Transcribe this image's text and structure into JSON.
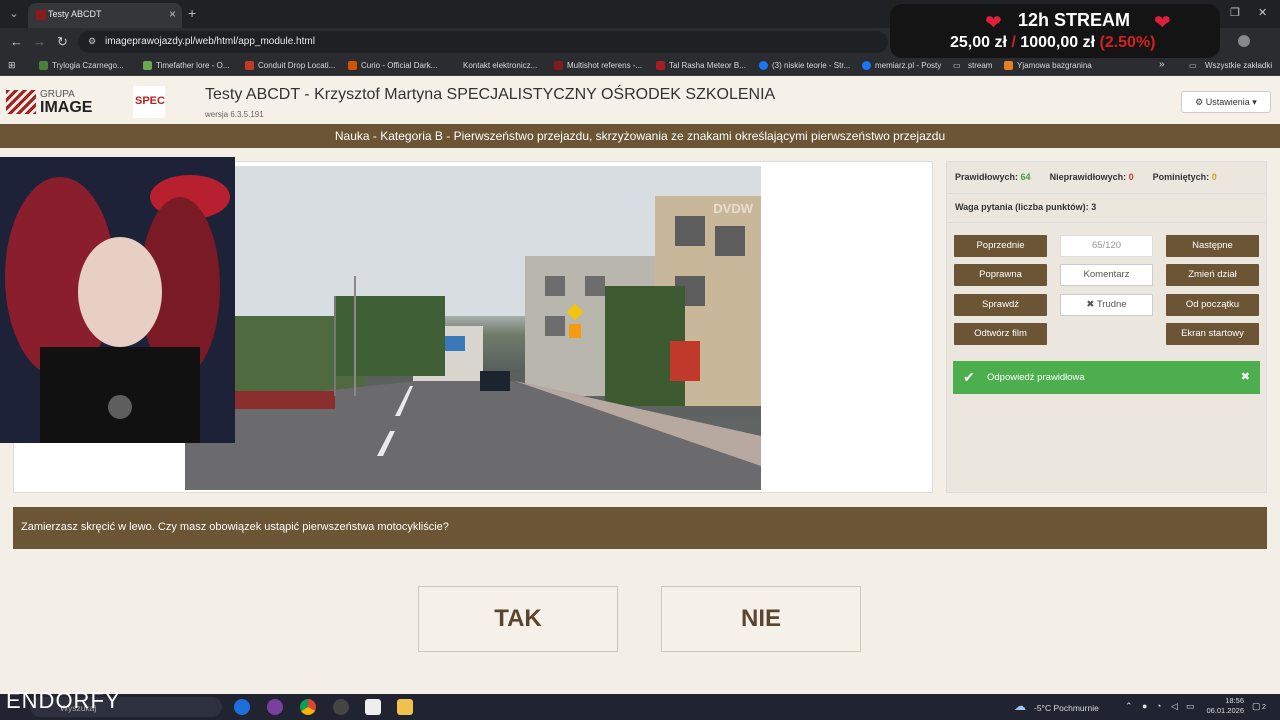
{
  "browser": {
    "tab_title": "Testy ABCDT",
    "url": "imageprawojazdy.pl/web/html/app_module.html",
    "bookmarks": [
      "Trylogia Czarnego...",
      "Timefather lore - O...",
      "Conduit Drop Locati...",
      "Curio - Official Dark...",
      "Kontakt elektronicz...",
      "Multishot referens -...",
      "Tal Rasha Meteor B...",
      "(3) niskie teorie - Str...",
      "memiarz.pl - Posty",
      "stream",
      "Yjamowa bazgranina"
    ],
    "all_bookmarks": "Wszystkie zakładki"
  },
  "stream_overlay": {
    "title": "12h STREAM",
    "raised": "25,00 zł",
    "separator": "/",
    "goal": "1000,00 zł",
    "percent": "(2.50%)"
  },
  "header": {
    "logo_line1": "GRUPA",
    "logo_line2": "IMAGE",
    "spec_logo": "SPEC",
    "title": "Testy ABCDT - Krzysztof Martyna SPECJALISTYCZNY OŚRODEK SZKOLENIA",
    "version": "wersja 6.3.5.191",
    "settings_label": "Ustawienia"
  },
  "category": "Nauka - Kategoria B - Pierwszeństwo przejazdu, skrzyżowania ze znakami określającymi pierwszeństwo przejazdu",
  "video": {
    "watermark": "DVDW"
  },
  "stats": {
    "correct_label": "Prawidłowych:",
    "correct_value": "64",
    "incorrect_label": "Nieprawidłowych:",
    "incorrect_value": "0",
    "skipped_label": "Pominiętych:",
    "skipped_value": "0",
    "weight_label": "Waga pytania (liczba punktów):",
    "weight_value": "3"
  },
  "controls": {
    "previous": "Poprzednie",
    "counter": "65/120",
    "next": "Następne",
    "correction": "Poprawna",
    "comment": "Komentarz",
    "change_section": "Zmień dział",
    "check": "Sprawdź",
    "difficult": "✖ Trudne",
    "from_start": "Od początku",
    "play_video": "Odtwórz film",
    "start_screen": "Ekran startowy"
  },
  "alert": {
    "message": "Odpowiedź prawidłowa"
  },
  "question": "Zamierzasz skręcić w lewo. Czy masz obowiązek ustąpić pierwszeństwa motocykliście?",
  "answers": {
    "yes": "TAK",
    "no": "NIE"
  },
  "taskbar": {
    "brand": "ENDORFY",
    "search": "Wyszukaj",
    "weather": "-5°C Pochmurnie",
    "time": "18:56",
    "date": "06.01.2026",
    "notifications": "2"
  },
  "colors": {
    "accent": "#6b5535",
    "success": "#4cae4c",
    "background": "#f3efe7"
  }
}
